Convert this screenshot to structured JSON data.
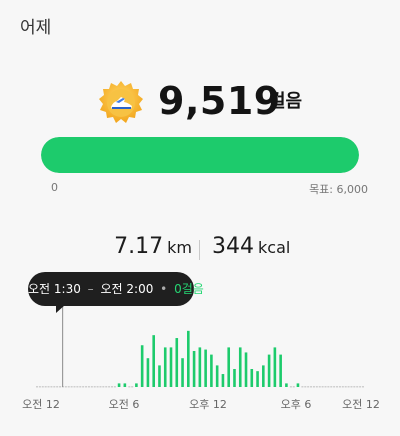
{
  "header": {
    "title": "어제"
  },
  "steps": {
    "value": "9,519",
    "unit": "걸음",
    "medal_icon": "sneaker-medal-icon"
  },
  "progress": {
    "fraction": 1.0,
    "min_label": "0",
    "goal_label": "목표: 6,000",
    "fill_color": "#1dcb6c",
    "track_color": "#e3e3e3"
  },
  "stats": {
    "distance_value": "7.17",
    "distance_unit": "km",
    "calories_value": "344",
    "calories_unit": "kcal"
  },
  "tooltip": {
    "start": "오전 1:30",
    "dash": "–",
    "end": "오전 2:00",
    "dot": "•",
    "value": "0걸음"
  },
  "chart_data": {
    "type": "bar",
    "x_tick_labels": [
      "오전 12",
      "오전 6",
      "오후 12",
      "오후 6",
      "오전 12"
    ],
    "values": [
      0,
      0,
      0,
      0,
      0,
      0,
      0,
      0,
      0,
      0,
      0,
      0,
      0,
      0,
      0,
      0,
      0,
      0,
      0,
      0,
      0,
      0,
      0,
      0,
      0,
      0,
      0,
      0,
      0.05,
      0.05,
      0.05,
      0.05,
      0,
      0,
      0.05,
      0.05,
      0.58,
      0.58,
      0.4,
      0.4,
      0.72,
      0.72,
      0.3,
      0.3,
      0.55,
      0.55,
      0.55,
      0.55,
      0.68,
      0.68,
      0.4,
      0.4,
      0.78,
      0.78,
      0.5,
      0.5,
      0.55,
      0.55,
      0.52,
      0.52,
      0.45,
      0.45,
      0.3,
      0.3,
      0.18,
      0.18,
      0.55,
      0.55,
      0.25,
      0.25,
      0.55,
      0.55,
      0.48,
      0.48,
      0.25,
      0.25,
      0.22,
      0.22,
      0.3,
      0.3,
      0.45,
      0.45,
      0.55,
      0.55,
      0.45,
      0.45,
      0.05,
      0.05,
      0,
      0,
      0.05,
      0.05,
      0,
      0,
      0,
      0,
      0,
      0,
      0,
      0,
      0,
      0,
      0,
      0,
      0,
      0,
      0,
      0,
      0,
      0,
      0,
      0,
      0,
      0
    ],
    "bar_color": "#1dcb6c",
    "baseline_color": "#cfcfcf",
    "selected_index": 3
  }
}
